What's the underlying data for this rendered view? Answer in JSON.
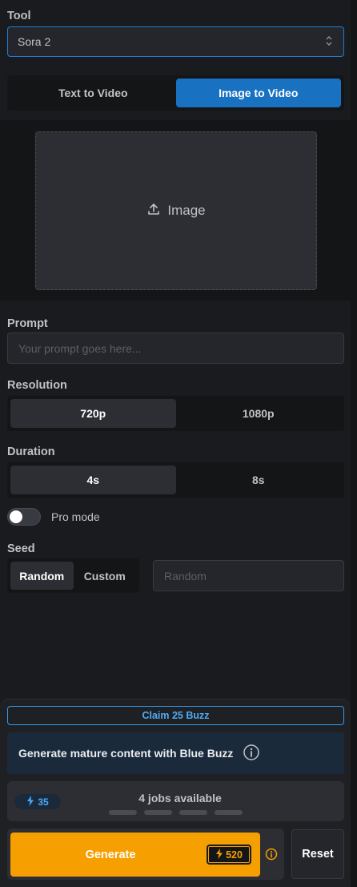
{
  "tool": {
    "label": "Tool",
    "selected": "Sora 2"
  },
  "mode_tabs": [
    "Text to Video",
    "Image to Video"
  ],
  "mode_active": 1,
  "image_upload": {
    "label": "Image"
  },
  "prompt": {
    "label": "Prompt",
    "placeholder": "Your prompt goes here..."
  },
  "resolution": {
    "label": "Resolution",
    "options": [
      "720p",
      "1080p"
    ],
    "active": 0
  },
  "duration": {
    "label": "Duration",
    "options": [
      "4s",
      "8s"
    ],
    "active": 0
  },
  "pro_mode": {
    "label": "Pro mode",
    "enabled": false
  },
  "seed": {
    "label": "Seed",
    "options": [
      "Random",
      "Custom"
    ],
    "active": 0,
    "placeholder": "Random"
  },
  "claim_button": "Claim 25 Buzz",
  "mature_banner": "Generate mature content with Blue Buzz",
  "jobs": {
    "buzz": "35",
    "text": "4 jobs available"
  },
  "generate": {
    "label": "Generate",
    "cost": "520"
  },
  "reset_label": "Reset",
  "colors": {
    "accent": "#1971c2",
    "generate": "#f59f00",
    "buzz_blue": "#4dabf7"
  }
}
